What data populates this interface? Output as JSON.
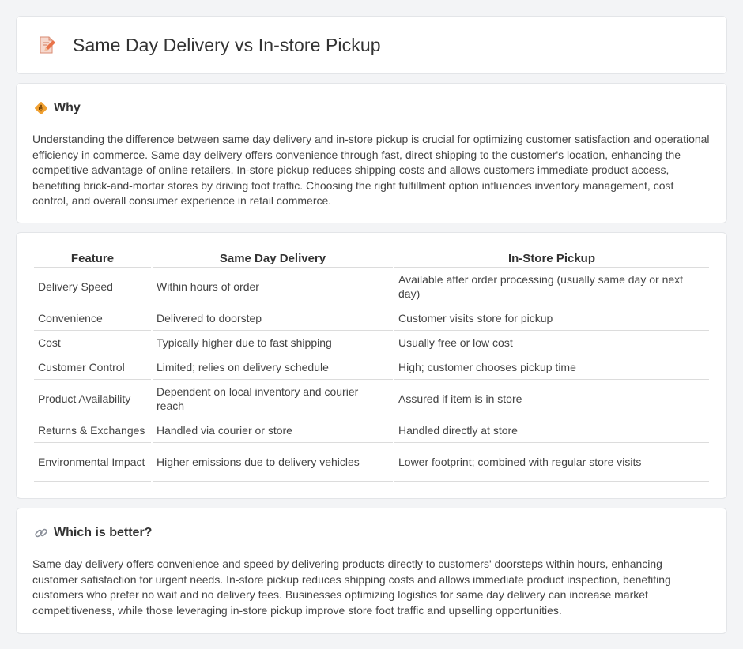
{
  "page": {
    "title": "Same Day Delivery vs In-store Pickup",
    "title_icon": "pencil-paper-icon"
  },
  "why": {
    "heading": "Why",
    "icon": "warning-sign-icon",
    "text": "Understanding the difference between same day delivery and in-store pickup is crucial for optimizing customer satisfaction and operational efficiency in commerce. Same day delivery offers convenience through fast, direct shipping to the customer's location, enhancing the competitive advantage of online retailers. In-store pickup reduces shipping costs and allows customers immediate product access, benefiting brick-and-mortar stores by driving foot traffic. Choosing the right fulfillment option influences inventory management, cost control, and overall consumer experience in retail commerce."
  },
  "table": {
    "headers": [
      "Feature",
      "Same Day Delivery",
      "In-Store Pickup"
    ],
    "rows": [
      [
        "Delivery Speed",
        "Within hours of order",
        "Available after order processing (usually same day or next day)"
      ],
      [
        "Convenience",
        "Delivered to doorstep",
        "Customer visits store for pickup"
      ],
      [
        "Cost",
        "Typically higher due to fast shipping",
        "Usually free or low cost"
      ],
      [
        "Customer Control",
        "Limited; relies on delivery schedule",
        "High; customer chooses pickup time"
      ],
      [
        "Product Availability",
        "Dependent on local inventory and courier reach",
        "Assured if item is in store"
      ],
      [
        "Returns & Exchanges",
        "Handled via courier or store",
        "Handled directly at store"
      ],
      [
        "Environmental Impact",
        "Higher emissions due to delivery vehicles",
        "Lower footprint; combined with regular store visits"
      ]
    ]
  },
  "which": {
    "heading": "Which is better?",
    "icon": "link-icon",
    "text": "Same day delivery offers convenience and speed by delivering products directly to customers' doorsteps within hours, enhancing customer satisfaction for urgent needs. In-store pickup reduces shipping costs and allows immediate product inspection, benefiting customers who prefer no wait and no delivery fees. Businesses optimizing logistics for same day delivery can increase market competitiveness, while those leveraging in-store pickup improve store foot traffic and upselling opportunities."
  },
  "colors": {
    "background": "#f3f4f6",
    "card": "#ffffff",
    "warning_icon": "#f0a030",
    "pencil_icon": "#e8734a"
  }
}
